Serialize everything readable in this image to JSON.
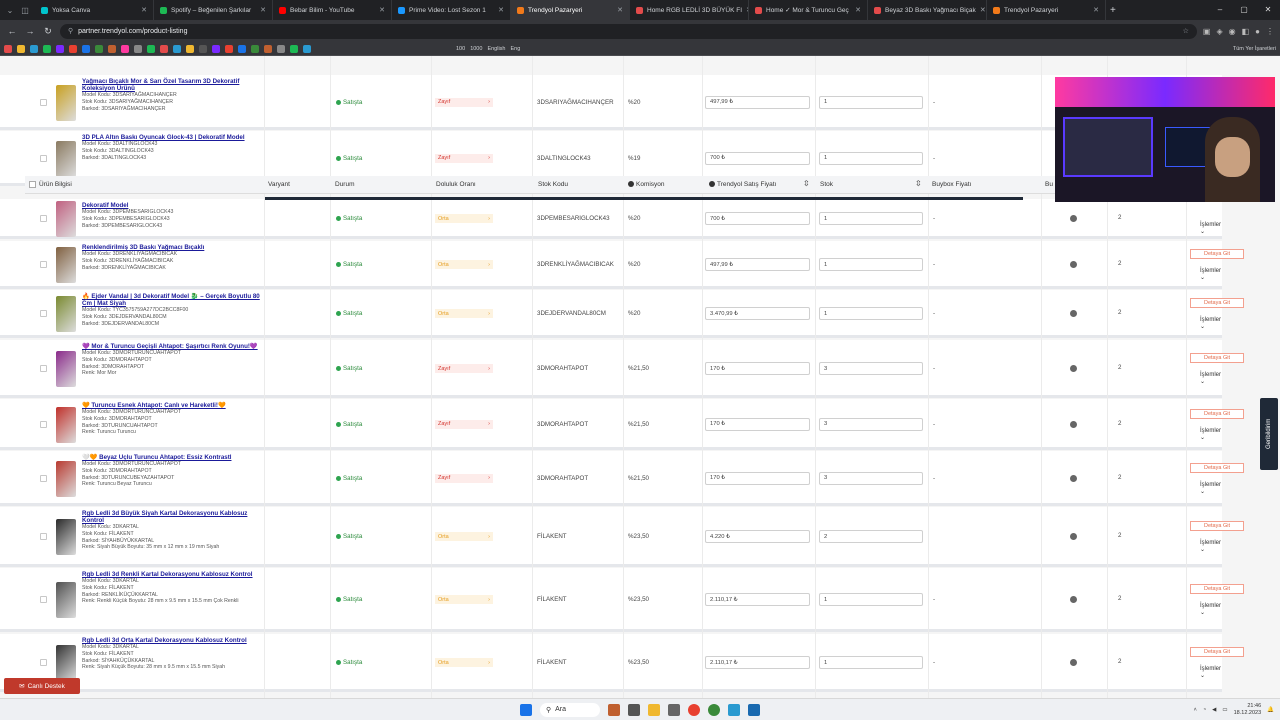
{
  "browser": {
    "tabs": [
      {
        "label": "Yoksa Canva",
        "color": "#00c4cc",
        "active": false
      },
      {
        "label": "Spotify – Beğenilen Şarkılar",
        "color": "#1db954",
        "active": false
      },
      {
        "label": "Bebar Bilim - YouTube",
        "color": "#ff0000",
        "active": false
      },
      {
        "label": "Prime Video: Lost Sezon 1",
        "color": "#1a98ff",
        "active": false
      },
      {
        "label": "Trendyol Pazaryeri",
        "color": "#f27a1a",
        "active": true
      },
      {
        "label": "Home RGB LEDLİ 3D BÜYÜK FI",
        "color": "#e34b4b",
        "active": false
      },
      {
        "label": "Home ✓ Mor & Turuncu Geç",
        "color": "#e34b4b",
        "active": false
      },
      {
        "label": "Beyaz 3D Baskı Yağmacı Biçak",
        "color": "#e34b4b",
        "active": false
      },
      {
        "label": "Trendyol Pazaryeri",
        "color": "#f27a1a",
        "active": false
      }
    ],
    "url": "partner.trendyol.com/product-listing",
    "bookmarks_label": "Tüm Yer İşaretleri",
    "bookmark_texts": [
      "100",
      "1000",
      "English",
      "Eng"
    ]
  },
  "table": {
    "headers": {
      "product": "Ürün Bilgisi",
      "variant": "Varyant",
      "status": "Durum",
      "fill_rate": "Doluluk Oranı",
      "stock_code": "Stok Kodu",
      "commission": "Komisyon",
      "price": "Trendyol Satış Fiyatı",
      "stock": "Stok",
      "buybox": "Buybox Fiyatı",
      "buybox_cut": "Bu"
    },
    "rows": [
      {
        "title": "Yağmacı Bıçaklı Mor & Sarı Özel Tasarım 3D Dekoratif Koleksiyon Ürünü",
        "meta": [
          "Model Kodu: 3DSARIYAĞMACIHANÇER",
          "Stok Kodu: 3DSARIYAĞMACIHANÇER",
          "Barkod: 3DSARIYAĞMACIHANÇER"
        ],
        "status": "Satışta",
        "fill": "Zayıf",
        "fill_level": "zayif",
        "stock_code": "3DSARIYAĞMACIHANÇER",
        "commission": "%20",
        "price": "497,99 ₺",
        "stock": "1",
        "buybox": "-",
        "thumb": "#c8a020"
      },
      {
        "title": "3D PLA Altın Baskı Oyuncak Glock-43 | Dekoratif Model",
        "meta": [
          "Model Kodu: 3DALTINGLOCK43",
          "Stok Kodu: 3DALTINGLOCK43",
          "Barkod: 3DALTINGLOCK43"
        ],
        "status": "Satışta",
        "fill": "Zayıf",
        "fill_level": "zayif",
        "stock_code": "3DALTINGLOCK43",
        "commission": "%19",
        "price": "700 ₺",
        "stock": "1",
        "buybox": "-",
        "thumb": "#8a7a60"
      },
      {
        "title": "Dekoratif Model",
        "meta": [
          "Model Kodu: 3DPEMBESARIGLOCK43",
          "Stok Kodu: 3DPEMBESARIGLOCK43",
          "Barkod: 3DPEMBESARIGLOCK43"
        ],
        "status": "Satışta",
        "fill": "Orta",
        "fill_level": "orta",
        "stock_code": "3DPEMBESARIGLOCK43",
        "commission": "%20",
        "price": "700 ₺",
        "stock": "1",
        "buybox": "-",
        "thumb": "#c06080"
      },
      {
        "title": "Renklendirilmiş 3D Baskı Yağmacı Bıçaklı",
        "meta": [
          "Model Kodu: 3DRENKLİYAĞMACIBICAK",
          "Stok Kodu: 3DRENKLİYAĞMACIBICAK",
          "Barkod: 3DRENKLİYAĞMACIBICAK"
        ],
        "status": "Satışta",
        "fill": "Orta",
        "fill_level": "orta",
        "stock_code": "3DRENKLİYAĞMACIBICAK",
        "commission": "%20",
        "price": "497,99 ₺",
        "stock": "1",
        "buybox": "-",
        "thumb": "#806040"
      },
      {
        "title": "🔥 Ejder Vandal | 3d Dekoratif Model 🐉 – Gerçek Boyutlu 80 Cm | Mat Siyah",
        "meta": [
          "Model Kodu: TYC3575759A277DC2BCC8F00",
          "Stok Kodu: 3DEJDERVANDAL80CM",
          "Barkod: 3DEJDERVANDAL80CM"
        ],
        "status": "Satışta",
        "fill": "Orta",
        "fill_level": "orta",
        "stock_code": "3DEJDERVANDAL80CM",
        "commission": "%20",
        "price": "3.470,99 ₺",
        "stock": "1",
        "buybox": "-",
        "thumb": "#7a8a30"
      },
      {
        "title": "💜 Mor & Turuncu Geçişli Ahtapot: Şaşırtıcı Renk Oyunu!💜",
        "meta": [
          "Model Kodu: 3DMORTURUNCUAHTAPOT",
          "Stok Kodu: 3DMORAHTAPOT",
          "Barkod: 3DMORAHTAPOT",
          "Renk: Mor Mor"
        ],
        "status": "Satışta",
        "fill": "Zayıf",
        "fill_level": "zayif",
        "stock_code": "3DMORAHTAPOT",
        "commission": "%21,50",
        "price": "170 ₺",
        "stock": "3",
        "buybox": "-",
        "thumb": "#8a2a8a"
      },
      {
        "title": "🧡 Turuncu Esnek Ahtapot: Canlı ve Hareketli!🧡",
        "meta": [
          "Model Kodu: 3DMORTURUNCUAHTAPOT",
          "Stok Kodu: 3DMORAHTAPOT",
          "Barkod: 3DTURUNCUAHTAPOT",
          "Renk: Turuncu Turuncu"
        ],
        "status": "Satışta",
        "fill": "Zayıf",
        "fill_level": "zayif",
        "stock_code": "3DMORAHTAPOT",
        "commission": "%21,50",
        "price": "170 ₺",
        "stock": "3",
        "buybox": "-",
        "thumb": "#c0302a"
      },
      {
        "title": "🤍🧡 Beyaz Uçlu Turuncu Ahtapot: Essiz Kontrastl",
        "meta": [
          "Model Kodu: 3DMORTURUNCUAHTAPOT",
          "Stok Kodu: 3DMORAHTAPOT",
          "Barkod: 3DTURUNCUBEYAZAHTAPOT",
          "Renk: Turuncu Beyaz Turuncu"
        ],
        "status": "Satışta",
        "fill": "Zayıf",
        "fill_level": "zayif",
        "stock_code": "3DMORAHTAPOT",
        "commission": "%21,50",
        "price": "170 ₺",
        "stock": "3",
        "buybox": "-",
        "thumb": "#b83a30"
      },
      {
        "title": "Rgb Ledli 3d Büyük Siyah Kartal Dekorasyonu Kablosuz Kontrol",
        "meta": [
          "Model Kodu: 3DKARTAL",
          "Stok Kodu: FİLAKENT",
          "Barkod: SİYAHBÜYÜKKARTAL",
          "Renk: Siyah Büyük Boyutu: 35 mm x 12 mm x 19 mm Siyah"
        ],
        "status": "Satışta",
        "fill": "Orta",
        "fill_level": "orta",
        "stock_code": "FİLAKENT",
        "commission": "%23,50",
        "price": "4.220 ₺",
        "stock": "2",
        "buybox": "",
        "thumb": "#2a2a2a"
      },
      {
        "title": "Rgb Ledli 3d Renkli Kartal Dekorasyonu Kablosuz Kontrol",
        "meta": [
          "Model Kodu: 3DKARTAL",
          "Stok Kodu: FİLAKENT",
          "Barkod: RENKLİKÜÇÜKKARTAL",
          "Renk: Renkli Küçük Boyutu: 28 mm x 9.5 mm x 15.5 mm Çok Renkli"
        ],
        "status": "Satışta",
        "fill": "Orta",
        "fill_level": "orta",
        "stock_code": "FİLAKENT",
        "commission": "%23,50",
        "price": "2.110,17 ₺",
        "stock": "1",
        "buybox": "-",
        "thumb": "#505050"
      },
      {
        "title": "Rgb Ledli 3d Orta Kartal Dekorasyonu Kablosuz Kontrol",
        "meta": [
          "Model Kodu: 3DKARTAL",
          "Stok Kodu: FİLAKENT",
          "Barkod: SİYAHKÜÇÜKKARTAL",
          "Renk: Siyah Küçük Boyutu: 28 mm x 9.5 mm x 15.5 mm Siyah"
        ],
        "status": "Satışta",
        "fill": "Orta",
        "fill_level": "orta",
        "stock_code": "FİLAKENT",
        "commission": "%23,50",
        "price": "2.110,17 ₺",
        "stock": "1",
        "buybox": "-",
        "thumb": "#333333"
      }
    ],
    "right_counts": [
      "2",
      "2",
      "2",
      "2",
      "2",
      "2",
      "2",
      "2",
      "2"
    ],
    "detay_label": "Detaya Git",
    "islemler_label": "İşlemler"
  },
  "side_tab": "Geribildirim",
  "help_button": "Canlı Destek",
  "taskbar": {
    "search": "Ara",
    "time": "21:46",
    "date": "18.12.2023"
  }
}
